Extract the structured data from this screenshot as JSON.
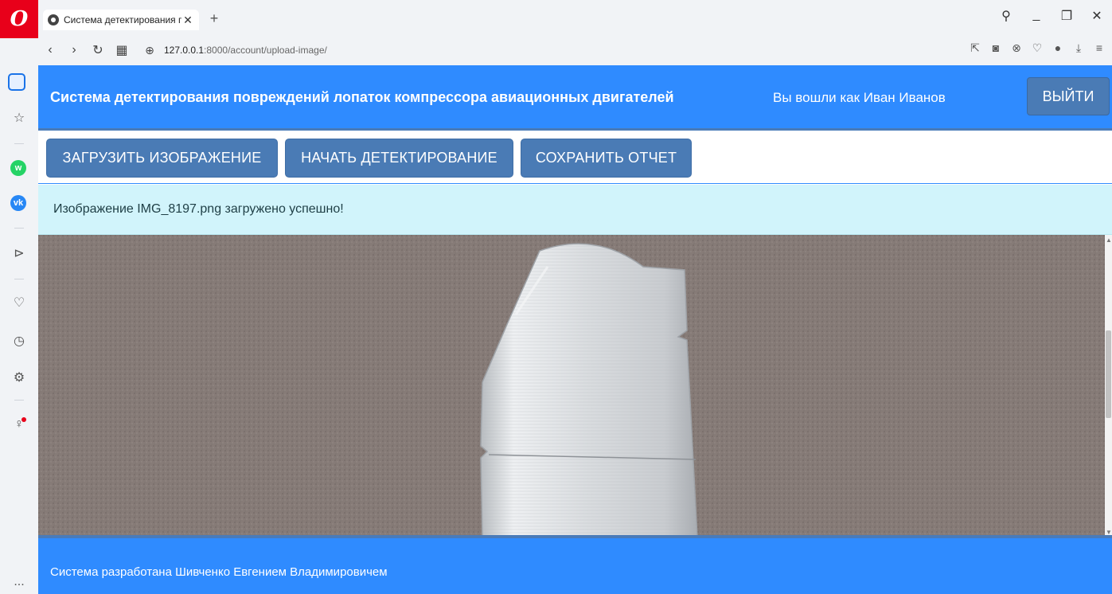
{
  "browser": {
    "tab_title": "Система детектирования п",
    "tab_close": "✕",
    "new_tab": "+",
    "url_host": "127.0.0.1",
    "url_path": ":8000/account/upload-image/"
  },
  "app": {
    "title": "Система детектирования повреждений лопаток компрессора авиационных двигателей",
    "user_text": "Вы вошли как Иван Иванов",
    "logout_label": "ВЫЙТИ"
  },
  "toolbar": {
    "upload_label": "ЗАГРУЗИТЬ ИЗОБРАЖЕНИЕ",
    "detect_label": "НАЧАТЬ ДЕТЕКТИРОВАНИЕ",
    "save_label": "СОХРАНИТЬ ОТЧЕТ"
  },
  "alert": {
    "message": "Изображение IMG_8197.png загружено успешно!"
  },
  "footer": {
    "text": "Система разработана Шивченко Евгением Владимировичем"
  },
  "sidebar": {
    "more_label": "..."
  },
  "colors": {
    "header_bg": "#2f8bff",
    "button_bg": "#4a7bb5",
    "alert_bg": "#d1f4fb",
    "opera_red": "#e8001a"
  }
}
